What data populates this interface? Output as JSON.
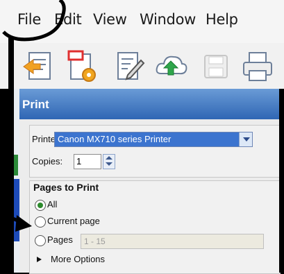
{
  "menubar": {
    "items": [
      "File",
      "Edit",
      "View",
      "Window",
      "Help"
    ]
  },
  "toolbar": {
    "icons": [
      "open-file-icon",
      "create-pdf-icon",
      "edit-document-icon",
      "upload-cloud-icon",
      "save-icon",
      "print-icon"
    ]
  },
  "dialog": {
    "title": "Print",
    "printer_label": "Printer:",
    "printer_value": "Canon MX710 series Printer",
    "copies_label": "Copies:",
    "copies_value": "1",
    "pages_to_print_title": "Pages to Print",
    "options": {
      "all": "All",
      "current": "Current page",
      "pages": "Pages"
    },
    "pages_range_placeholder": "1 - 15",
    "more_options": "More Options"
  },
  "colors": {
    "title_bar": "#2f66b4",
    "selected_dropdown": "#3c74cf"
  }
}
